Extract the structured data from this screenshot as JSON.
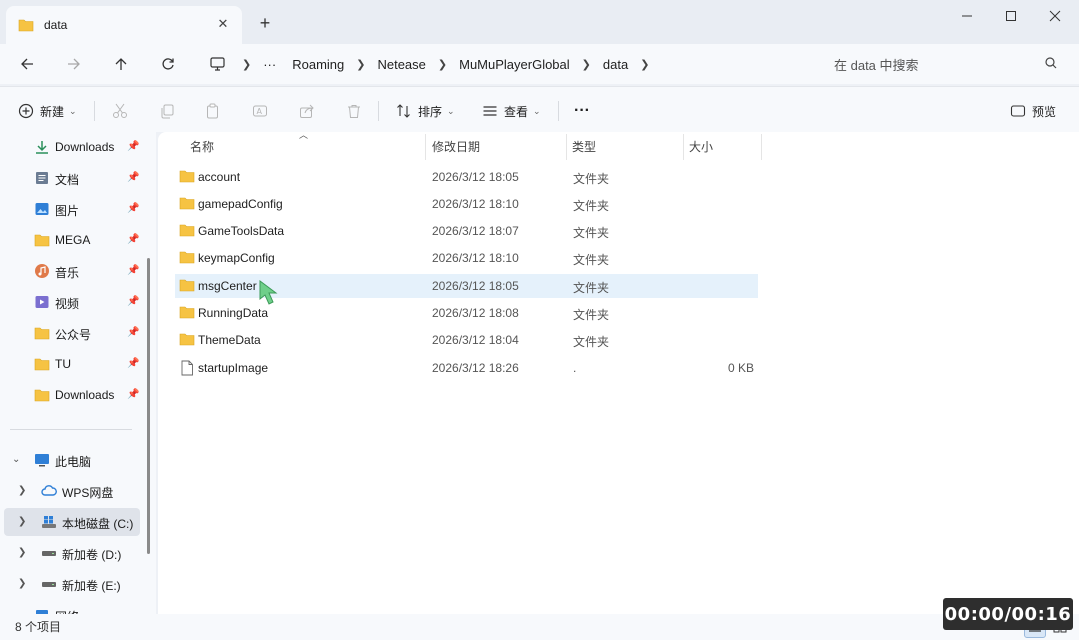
{
  "window": {
    "tab_title": "data",
    "new_tab": "+",
    "tab_close": "✕"
  },
  "addressbar": {
    "more": "···",
    "crumbs": [
      "Roaming",
      "Netease",
      "MuMuPlayerGlobal",
      "data"
    ],
    "search_placeholder": "在 data 中搜索"
  },
  "commandbar": {
    "new_label": "新建",
    "sort_label": "排序",
    "view_label": "查看",
    "more": "···",
    "preview_label": "预览"
  },
  "sidebar": {
    "quick_access": [
      {
        "label": "Downloads",
        "icon": "download-icon",
        "pinned": true
      },
      {
        "label": "文档",
        "icon": "document-icon",
        "pinned": true
      },
      {
        "label": "图片",
        "icon": "picture-icon",
        "pinned": true
      },
      {
        "label": "MEGA",
        "icon": "folder-icon",
        "pinned": true
      },
      {
        "label": "音乐",
        "icon": "music-icon",
        "pinned": true
      },
      {
        "label": "视频",
        "icon": "video-icon",
        "pinned": true
      },
      {
        "label": "公众号",
        "icon": "folder-icon",
        "pinned": true
      },
      {
        "label": "TU",
        "icon": "folder-icon",
        "pinned": true
      },
      {
        "label": "Downloads",
        "icon": "folder-icon",
        "pinned": true
      }
    ],
    "this_pc": "此电脑",
    "drives": [
      {
        "label": "WPS网盘",
        "icon": "cloud-icon"
      },
      {
        "label": "本地磁盘 (C:)",
        "icon": "windows-drive-icon",
        "selected": true
      },
      {
        "label": "新加卷 (D:)",
        "icon": "drive-icon"
      },
      {
        "label": "新加卷 (E:)",
        "icon": "drive-icon"
      }
    ],
    "cut_off_label": "网络"
  },
  "columns": {
    "name": "名称",
    "date": "修改日期",
    "type": "类型",
    "size": "大小"
  },
  "files": [
    {
      "name": "account",
      "date": "2026/3/12 18:05",
      "type": "文件夹",
      "size": "",
      "kind": "folder"
    },
    {
      "name": "gamepadConfig",
      "date": "2026/3/12 18:10",
      "type": "文件夹",
      "size": "",
      "kind": "folder"
    },
    {
      "name": "GameToolsData",
      "date": "2026/3/12 18:07",
      "type": "文件夹",
      "size": "",
      "kind": "folder"
    },
    {
      "name": "keymapConfig",
      "date": "2026/3/12 18:10",
      "type": "文件夹",
      "size": "",
      "kind": "folder"
    },
    {
      "name": "msgCenter",
      "date": "2026/3/12 18:05",
      "type": "文件夹",
      "size": "",
      "kind": "folder",
      "selected": true
    },
    {
      "name": "RunningData",
      "date": "2026/3/12 18:08",
      "type": "文件夹",
      "size": "",
      "kind": "folder"
    },
    {
      "name": "ThemeData",
      "date": "2026/3/12 18:04",
      "type": "文件夹",
      "size": "",
      "kind": "folder"
    },
    {
      "name": "startupImage",
      "date": "2026/3/12 18:26",
      "type": ".",
      "size": "0 KB",
      "kind": "file"
    }
  ],
  "status": {
    "item_count": "8 个项目"
  },
  "timer": "00:00/00:16",
  "colors": {
    "folder": "#f6c343",
    "selected_row": "#e5f1fb",
    "accent": "#0067c0"
  }
}
